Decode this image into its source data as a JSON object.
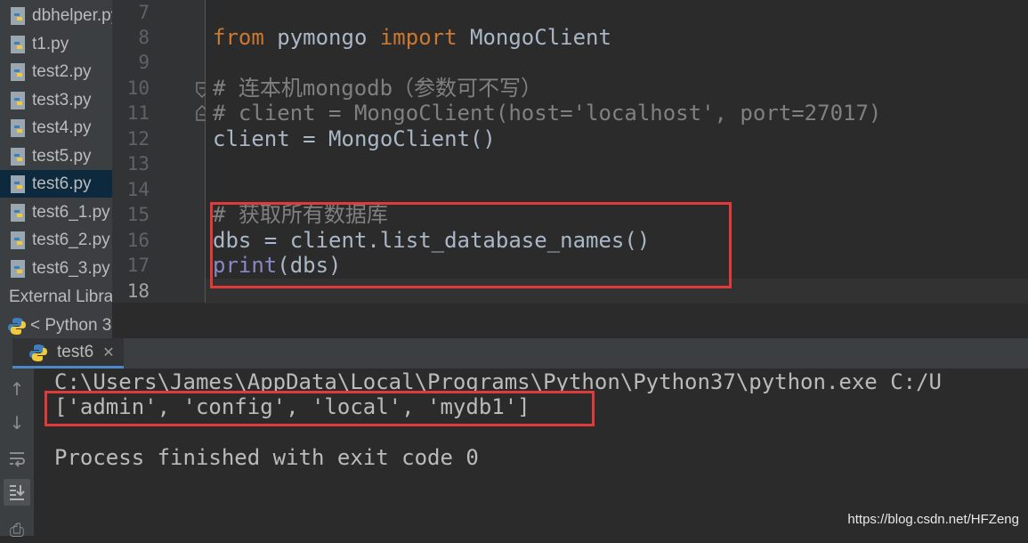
{
  "project_tree": {
    "files": [
      "dbhelper.py",
      "t1.py",
      "test2.py",
      "test3.py",
      "test4.py",
      "test5.py",
      "test6.py",
      "test6_1.py",
      "test6_2.py",
      "test6_3.py"
    ],
    "selected": "test6.py",
    "external_libraries": "External Libraries",
    "python_sdk": "< Python 3"
  },
  "editor": {
    "lines": [
      {
        "n": "7",
        "text": ""
      },
      {
        "n": "8",
        "kw1": "from",
        "mid": " pymongo ",
        "kw2": "import",
        "rest": " MongoClient"
      },
      {
        "n": "9",
        "text": ""
      },
      {
        "n": "10",
        "comment": "# 连本机mongodb（参数可不写）"
      },
      {
        "n": "11",
        "comment": "# client = MongoClient(host='localhost', port=27017)"
      },
      {
        "n": "12",
        "text": "client = MongoClient()"
      },
      {
        "n": "13",
        "text": ""
      },
      {
        "n": "14",
        "text": ""
      },
      {
        "n": "15",
        "comment": "# 获取所有数据库"
      },
      {
        "n": "16",
        "text": "dbs = client.list_database_names()"
      },
      {
        "n": "17",
        "builtin": "print",
        "rest": "(dbs)"
      },
      {
        "n": "18",
        "text": ""
      }
    ],
    "current_line": "18"
  },
  "run": {
    "tab_label": "test6",
    "output": [
      "C:\\Users\\James\\AppData\\Local\\Programs\\Python\\Python37\\python.exe C:/U",
      "['admin', 'config', 'local', 'mydb1']",
      "",
      "Process finished with exit code 0"
    ]
  },
  "watermark": "https://blog.csdn.net/HFZeng",
  "colors": {
    "keyword": "#cc7832",
    "comment": "#808080",
    "builtin": "#8888c6",
    "highlight_box": "#e03a3a"
  },
  "icons": {
    "python_file": "python-file-icon",
    "rerun": "up-arrow-icon",
    "down": "down-arrow-icon",
    "wrap": "soft-wrap-icon",
    "scroll": "scroll-to-end-icon"
  }
}
